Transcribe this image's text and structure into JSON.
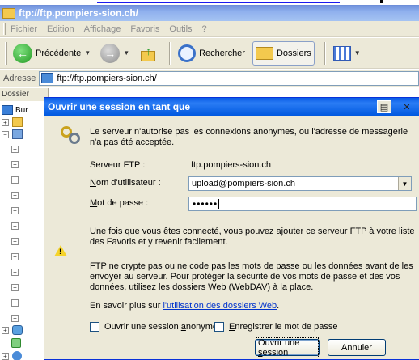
{
  "window": {
    "title": "ftp://ftp.pompiers-sion.ch/"
  },
  "menu": {
    "items": [
      "Fichier",
      "Edition",
      "Affichage",
      "Favoris",
      "Outils",
      "?"
    ]
  },
  "toolbar": {
    "back_label": "Précédente",
    "search_label": "Rechercher",
    "folders_label": "Dossiers"
  },
  "address": {
    "label": "Adresse",
    "value": "ftp://ftp.pompiers-sion.ch/"
  },
  "left_pane": {
    "title": "Dossier",
    "first_item": "Bur"
  },
  "dialog": {
    "title": "Ouvrir une session en tant que",
    "intro": "Le serveur n'autorise pas les connexions anonymes, ou l'adresse de messagerie n'a pas été acceptée.",
    "server_label": "Serveur FTP :",
    "server_value": "ftp.pompiers-sion.ch",
    "user_label_prefix": "N",
    "user_label_rest": "om d'utilisateur :",
    "user_value": "upload@pompiers-sion.ch",
    "password_label_prefix": "M",
    "password_label_rest": "ot de passe :",
    "password_mask": "••••••",
    "favorites_text": "Une fois que vous êtes connecté, vous pouvez ajouter ce serveur FTP à votre liste des Favoris et y revenir facilement.",
    "warning_text": "FTP ne crypte pas ou ne code pas les mots de passe ou les données avant de les envoyer au serveur. Pour protéger la sécurité de vos mots de passe et des vos données, utilisez les dossiers Web (WebDAV) à la place.",
    "learn_prefix": "En savoir plus sur ",
    "learn_link": "l'utilisation des dossiers Web",
    "learn_suffix": ".",
    "anon_checkbox_prefix": "Ouvrir une session ",
    "anon_checkbox_underline": "a",
    "anon_checkbox_rest": "nonyme",
    "save_pwd_prefix": "E",
    "save_pwd_rest": "nregistrer le mot de passe",
    "login_button_prefix": "Ouvrir une ",
    "login_button_underline": "s",
    "login_button_rest": "ession",
    "cancel_button": "Annuler"
  },
  "colors": {
    "dialog_title": "#0a5ce6",
    "link": "#0033cc",
    "face": "#ece9d8"
  }
}
